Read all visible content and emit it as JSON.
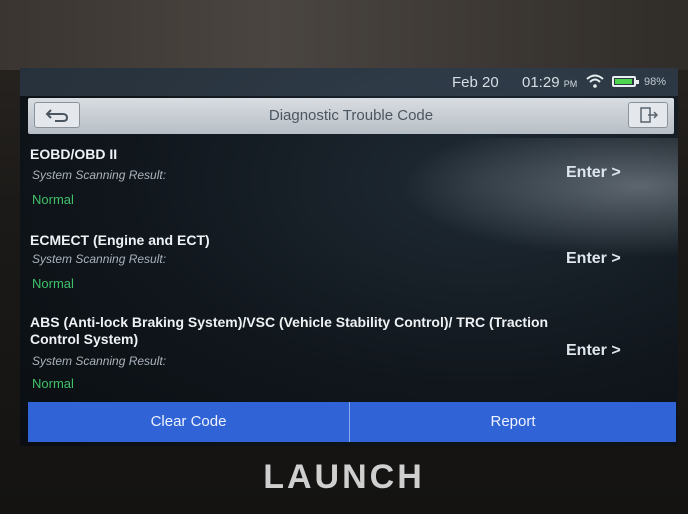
{
  "status_bar": {
    "date": "Feb 20",
    "time": "01:29",
    "ampm": "PM",
    "battery": "98%"
  },
  "header": {
    "title": "Diagnostic Trouble Code"
  },
  "systems": [
    {
      "name": "EOBD/OBD II",
      "result_label": "System Scanning Result:",
      "status": "Normal",
      "action": "Enter >"
    },
    {
      "name": "ECMECT (Engine and ECT)",
      "result_label": "System Scanning Result:",
      "status": "Normal",
      "action": "Enter >"
    },
    {
      "name": "ABS (Anti-lock Braking System)/VSC (Vehicle Stability Control)/ TRC (Traction Control System)",
      "result_label": "System Scanning Result:",
      "status": "Normal",
      "action": "Enter >"
    }
  ],
  "footer": {
    "clear_code_label": "Clear Code",
    "report_label": "Report"
  },
  "brand": "LAUNCH",
  "colors": {
    "status_normal": "#3fc16a",
    "action_bar": "#2f63d6",
    "title_bar": "#c8ced4"
  }
}
